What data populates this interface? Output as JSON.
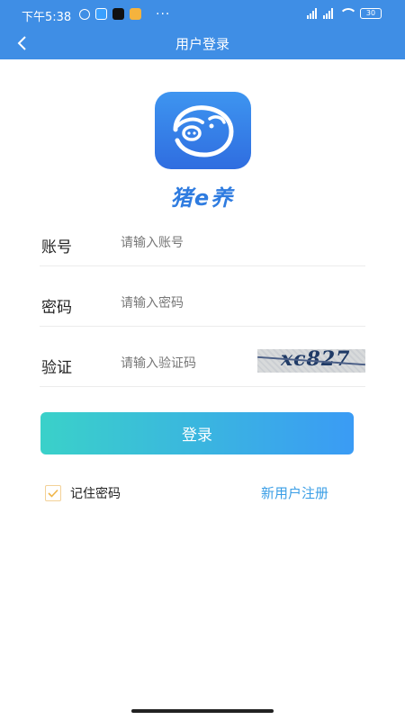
{
  "status_bar": {
    "time": "下午5:38",
    "more": "···",
    "battery": "30"
  },
  "header": {
    "title": "用户登录"
  },
  "brand": {
    "name": "猪e养"
  },
  "form": {
    "account": {
      "label": "账号",
      "placeholder": "请输入账号",
      "value": ""
    },
    "password": {
      "label": "密码",
      "placeholder": "请输入密码",
      "value": ""
    },
    "captcha": {
      "label": "验证",
      "placeholder": "请输入验证码",
      "value": "",
      "image_text": "xc827"
    }
  },
  "actions": {
    "login_label": "登录",
    "remember_label": "记住密码",
    "remember_checked": true,
    "register_label": "新用户注册"
  },
  "colors": {
    "header_bg": "#3f8ee5",
    "button_gradient_start": "#3ad1c9",
    "button_gradient_end": "#3a9bf5",
    "link": "#3a9ee6"
  }
}
